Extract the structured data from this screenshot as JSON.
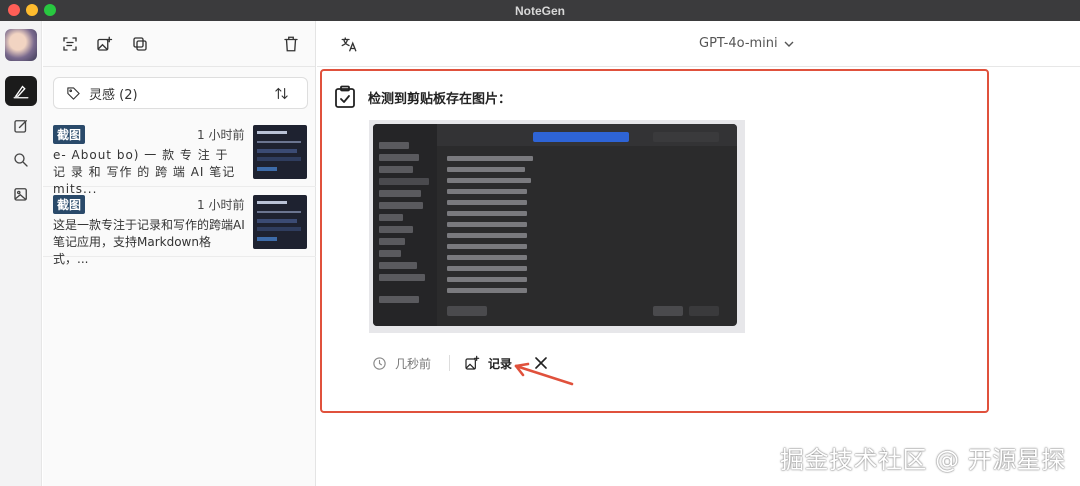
{
  "window": {
    "title": "NoteGen"
  },
  "list": {
    "tag_filter": "灵感 (2)",
    "notes": [
      {
        "badge": "截图",
        "time": "1 小时前",
        "text": "e- About bo) 一 款 专 注 于 记 录 和 写作 的 跨 端 AI 笔记 mits..."
      },
      {
        "badge": "截图",
        "time": "1 小时前",
        "text": "这是一款专注于记录和写作的跨端AI笔记应用，支持Markdown格式，..."
      }
    ]
  },
  "main": {
    "model": "GPT-4o-mini",
    "clipboard_card": {
      "title": "检测到剪贴板存在图片：",
      "time": "几秒前",
      "record_label": "记录"
    }
  },
  "watermark": "掘金技术社区 @ 开源星探",
  "colors": {
    "highlight_border": "#e0513c",
    "badge_bg": "#2a4a6a",
    "arrow": "#e0513c"
  }
}
